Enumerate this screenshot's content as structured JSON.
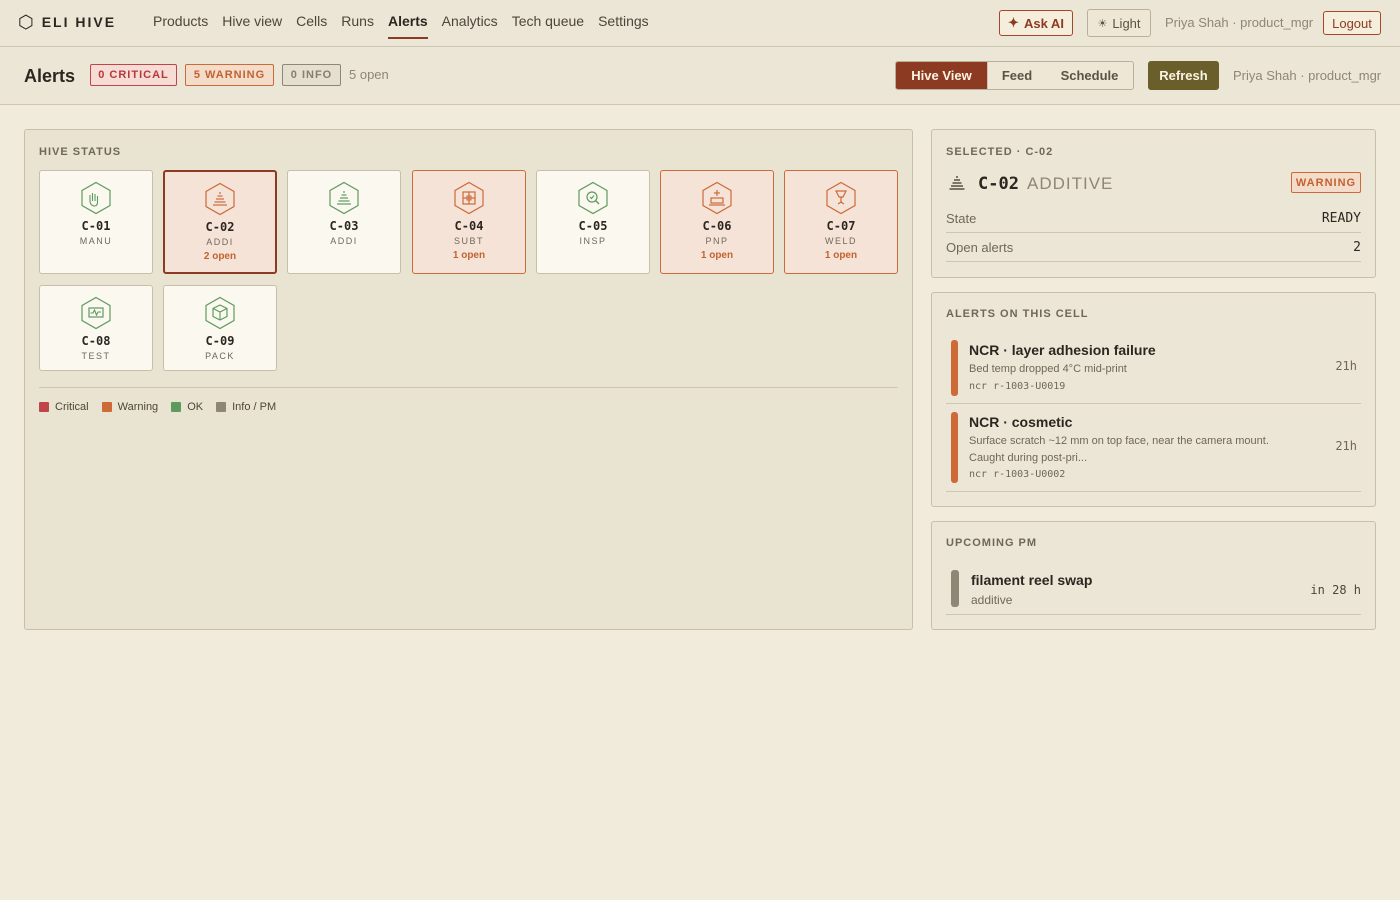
{
  "app": {
    "brand_mark": "⬡",
    "brand": "ELI HIVE"
  },
  "nav": {
    "links": [
      "Products",
      "Hive view",
      "Cells",
      "Runs",
      "Alerts",
      "Analytics",
      "Tech queue",
      "Settings"
    ],
    "active": "Alerts",
    "ask_ai": "Ask AI",
    "ask_ai_icon": "✦",
    "theme": "Light",
    "theme_icon": "☀",
    "user": "Priya Shah · product_mgr",
    "logout": "Logout"
  },
  "header": {
    "title": "Alerts",
    "badges": {
      "critical": "0 CRITICAL",
      "warning": "5 WARNING",
      "info": "0 INFO"
    },
    "open_count": "5 open",
    "views": [
      "Hive View",
      "Feed",
      "Schedule"
    ],
    "active_view": "Hive View",
    "refresh": "Refresh",
    "user": "Priya Shah · product_mgr"
  },
  "hive": {
    "label": "HIVE STATUS",
    "cells": [
      {
        "id": "C-01",
        "type": "MANU",
        "icon": "hand-icon",
        "status": "ok",
        "open": ""
      },
      {
        "id": "C-02",
        "type": "ADDI",
        "icon": "additive-layers-icon",
        "status": "warning",
        "open": "2 open",
        "selected": true
      },
      {
        "id": "C-03",
        "type": "ADDI",
        "icon": "additive-layers-icon",
        "status": "ok",
        "open": ""
      },
      {
        "id": "C-04",
        "type": "SUBT",
        "icon": "subtractive-icon",
        "status": "warning",
        "open": "1 open"
      },
      {
        "id": "C-05",
        "type": "INSP",
        "icon": "inspect-icon",
        "status": "ok",
        "open": ""
      },
      {
        "id": "C-06",
        "type": "PNP",
        "icon": "pick-place-icon",
        "status": "warning",
        "open": "1 open"
      },
      {
        "id": "C-07",
        "type": "WELD",
        "icon": "weld-icon",
        "status": "warning",
        "open": "1 open"
      },
      {
        "id": "C-08",
        "type": "TEST",
        "icon": "test-icon",
        "status": "ok",
        "open": ""
      },
      {
        "id": "C-09",
        "type": "PACK",
        "icon": "pack-icon",
        "status": "ok",
        "open": ""
      }
    ],
    "legend": [
      {
        "label": "Critical",
        "color": "#c0454a"
      },
      {
        "label": "Warning",
        "color": "#cc6a38"
      },
      {
        "label": "OK",
        "color": "#5e9a5e"
      },
      {
        "label": "Info / PM",
        "color": "#8e8776"
      }
    ]
  },
  "selected": {
    "label": "SELECTED · C-02",
    "icon": "additive-layers-icon",
    "id": "C-02",
    "type": "ADDITIVE",
    "badge": "WARNING",
    "state_label": "State",
    "state": "READY",
    "alerts_label": "Open alerts",
    "alerts": "2"
  },
  "cell_alerts": {
    "label": "ALERTS ON THIS CELL",
    "items": [
      {
        "title": "NCR · layer adhesion failure",
        "desc": "Bed temp dropped 4°C mid-print",
        "ref": "ncr  r-1003-U0019",
        "age": "21h"
      },
      {
        "title": "NCR · cosmetic",
        "desc": "Surface scratch ~12 mm on top face, near the camera mount. Caught during post-pri...",
        "ref": "ncr  r-1003-U0002",
        "age": "21h"
      }
    ]
  },
  "pm": {
    "label": "UPCOMING PM",
    "items": [
      {
        "title": "filament reel swap",
        "sub": "additive",
        "due": "in 28 h"
      }
    ]
  },
  "colors": {
    "accent": "#8c3b22",
    "warning": "#cc6a38",
    "ok": "#5e9a5e",
    "refresh": "#6a5f2a"
  }
}
